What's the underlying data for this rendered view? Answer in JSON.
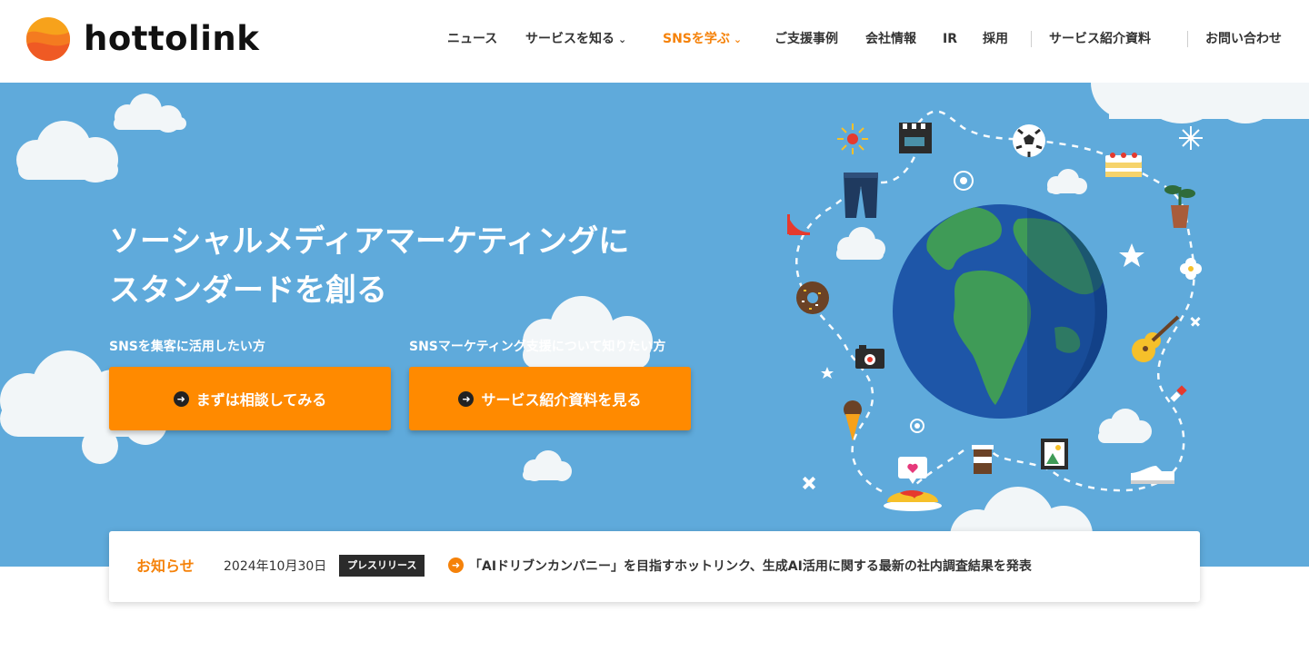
{
  "brand": {
    "name": "hottolink",
    "colors": {
      "accent": "#f5820a",
      "button": "#ff8a00",
      "hero_bg": "#5faadb"
    }
  },
  "nav": {
    "items": [
      {
        "label": "ニュース"
      },
      {
        "label": "サービスを知る",
        "icon": "chevron-down-icon"
      },
      {
        "label": "SNSを学ぶ",
        "icon": "chevron-down-icon",
        "active": true
      },
      {
        "label": "ご支援事例"
      },
      {
        "label": "会社情報"
      },
      {
        "label": "IR"
      },
      {
        "label": "採用"
      },
      {
        "label": "サービス紹介資料"
      },
      {
        "label": "お問い合わせ"
      }
    ]
  },
  "hero": {
    "title_line1": "ソーシャルメディアマーケティングに",
    "title_line2": "スタンダードを創る",
    "cta1": {
      "caption": "SNSを集客に活用したい方",
      "label": "まずは相談してみる",
      "icon": "arrow-right-icon"
    },
    "cta2": {
      "caption": "SNSマーケティング支援について知りたい方",
      "label": "サービス紹介資料を見る",
      "icon": "arrow-right-icon"
    }
  },
  "news": {
    "heading": "お知らせ",
    "date": "2024年10月30日",
    "category": "プレスリリース",
    "title": "「AIドリブンカンパニー」を目指すホットリンク、生成AI活用に関する最新の社内調査結果を発表",
    "icon": "arrow-right-icon"
  }
}
